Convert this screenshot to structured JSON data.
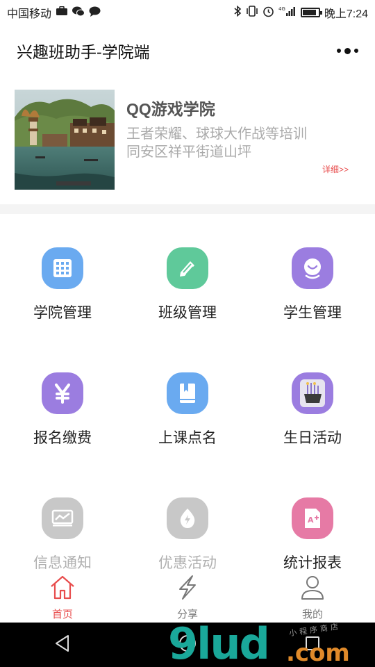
{
  "status_bar": {
    "carrier": "中国移动",
    "time": "晚上7:24",
    "network": "4G",
    "battery_level": 0.85
  },
  "navbar": {
    "title": "兴趣班助手-学院端"
  },
  "college": {
    "name": "QQ游戏学院",
    "description": "王者荣耀、球球大作战等培训",
    "address": "同安区祥平街道山坪",
    "detail_link": "详细>>"
  },
  "menu": [
    {
      "label": "学院管理",
      "icon": "grid-icon",
      "color": "#6aaaf0",
      "enabled": true
    },
    {
      "label": "班级管理",
      "icon": "edit-icon",
      "color": "#5fc99a",
      "enabled": true
    },
    {
      "label": "学生管理",
      "icon": "student-icon",
      "color": "#9b7de0",
      "enabled": true
    },
    {
      "label": "报名缴费",
      "icon": "yen-icon",
      "color": "#9b7de0",
      "enabled": true
    },
    {
      "label": "上课点名",
      "icon": "book-icon",
      "color": "#6aaaf0",
      "enabled": true
    },
    {
      "label": "生日活动",
      "icon": "birthday-cake-icon",
      "color": "#9b7de0",
      "enabled": true
    },
    {
      "label": "信息通知",
      "icon": "notice-icon",
      "color": "#c8c8c8",
      "enabled": false
    },
    {
      "label": "优惠活动",
      "icon": "flash-icon",
      "color": "#c8c8c8",
      "enabled": false
    },
    {
      "label": "统计报表",
      "icon": "report-icon",
      "color": "#e67aa5",
      "enabled": true
    }
  ],
  "tabbar": {
    "home": "首页",
    "share": "分享",
    "mine": "我的",
    "active_color": "#e84d4d"
  },
  "watermark": {
    "main": "9lud",
    "domain": ".com",
    "slogan": "小程序商店"
  }
}
